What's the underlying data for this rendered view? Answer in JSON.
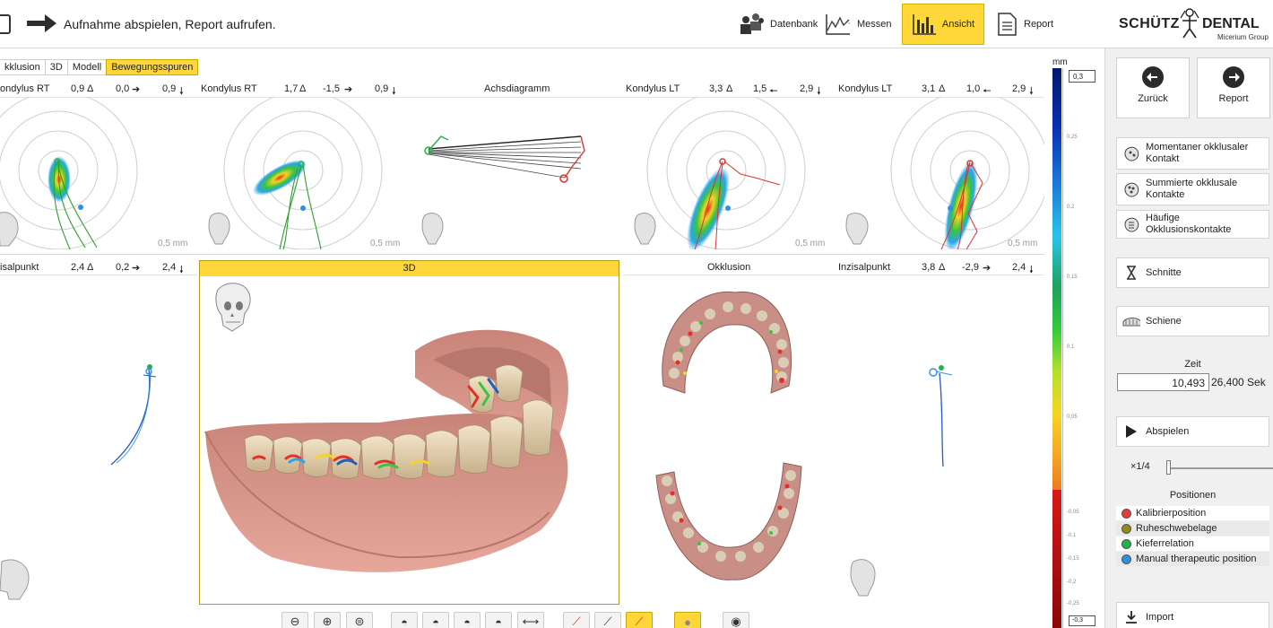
{
  "topbar": {
    "instruction": "Aufnahme abspielen, Report aufrufen.",
    "buttons": [
      {
        "label": "Datenbank",
        "icon": "database-people-icon"
      },
      {
        "label": "Messen",
        "icon": "measure-chart-icon"
      },
      {
        "label": "Ansicht",
        "icon": "bar-chart-icon"
      },
      {
        "label": "Report",
        "icon": "document-icon"
      }
    ],
    "active": "Ansicht",
    "logo": {
      "part1": "SCHÜTZ",
      "part2": "DENTAL",
      "sub": "Micerium Group"
    }
  },
  "view_tabs": [
    {
      "label": "kklusion",
      "active": false
    },
    {
      "label": "3D",
      "active": false
    },
    {
      "label": "Modell",
      "active": false
    },
    {
      "label": "Bewegungsspuren",
      "active": true
    }
  ],
  "panels_top": [
    {
      "title": "ondylus RT",
      "v1": "0,9",
      "s1": "Δ",
      "v2": "0,0",
      "s2": "➔",
      "v3": "0,9",
      "s3": "🠗",
      "scale": "0,5 mm"
    },
    {
      "title": "Kondylus RT",
      "v1": "1,7",
      "s1": "Δ",
      "v2": "-1,5",
      "s2": "➔",
      "v3": "0,9",
      "s3": "🠗",
      "scale": "0,5 mm"
    },
    {
      "title": "Achsdiagramm"
    },
    {
      "title": "Kondylus LT",
      "v1": "3,3",
      "s1": "Δ",
      "v2": "1,5",
      "s2": "🠔",
      "v3": "2,9",
      "s3": "🠗",
      "scale": "0,5 mm"
    },
    {
      "title": "Kondylus LT",
      "v1": "3,1",
      "s1": "Δ",
      "v2": "1,0",
      "s2": "🠔",
      "v3": "2,9",
      "s3": "🠗",
      "scale": "0,5 mm"
    }
  ],
  "panels_bottom": [
    {
      "title": "isalpunkt",
      "v1": "2,4",
      "s1": "Δ",
      "v2": "0,2",
      "s2": "➔",
      "v3": "2,4",
      "s3": "🠗"
    },
    {
      "title": "3D"
    },
    {
      "title": "Okklusion"
    },
    {
      "title": "Inzisalpunkt",
      "v1": "3,8",
      "s1": "Δ",
      "v2": "-2,9",
      "s2": "➔",
      "v3": "2,4",
      "s3": "🠗"
    }
  ],
  "scale": {
    "unit": "mm",
    "top_value": "0,3",
    "bottom_value": "-0,3",
    "ticks_pos": [
      "0,25",
      "0,2",
      "0,15",
      "0,1",
      "0,05"
    ],
    "ticks_neg": [
      "-0,05",
      "-0,1",
      "-0,15",
      "-0,2",
      "-0,25"
    ]
  },
  "right_panel": {
    "back": "Zurück",
    "report": "Report",
    "buttons": [
      {
        "label": "Momentaner okklusaler Kontakt",
        "icon": "tooth-contact-icon"
      },
      {
        "label": "Summierte okklusale Kontakte",
        "icon": "tooth-contact-sum-icon"
      },
      {
        "label": "Häufige Okklusionskontakte",
        "icon": "tooth-frequent-icon"
      },
      {
        "label": "Schnitte",
        "icon": "hourglass-icon"
      },
      {
        "label": "Schiene",
        "icon": "splint-icon"
      }
    ],
    "zeit_label": "Zeit",
    "zeit_value": "10,493",
    "zeit_total": "26,400 Sek",
    "play_label": "Abspielen",
    "speed_label": "×1/4",
    "speed_level": 0.0,
    "positions_title": "Positionen",
    "positions": [
      {
        "label": "Kalibrierposition",
        "color": "#e23b3b"
      },
      {
        "label": "Ruheschwebelage",
        "color": "#8f8a1a"
      },
      {
        "label": "Kieferrelation",
        "color": "#22b14c"
      },
      {
        "label": "Manual therapeutic position",
        "color": "#2f8fe0"
      }
    ],
    "import_label": "Import"
  },
  "bottom_toolbar": [
    "zoom-out-icon",
    "zoom-in-icon",
    "zoom-fit-icon",
    "skull-front-icon",
    "skull-side-icon",
    "skull-back-icon",
    "skull-bottom-icon",
    "axis-icon",
    "trace-red-icon",
    "trace-white-icon",
    "trace-yellow-icon",
    "contact-icon",
    "eye-icon"
  ]
}
